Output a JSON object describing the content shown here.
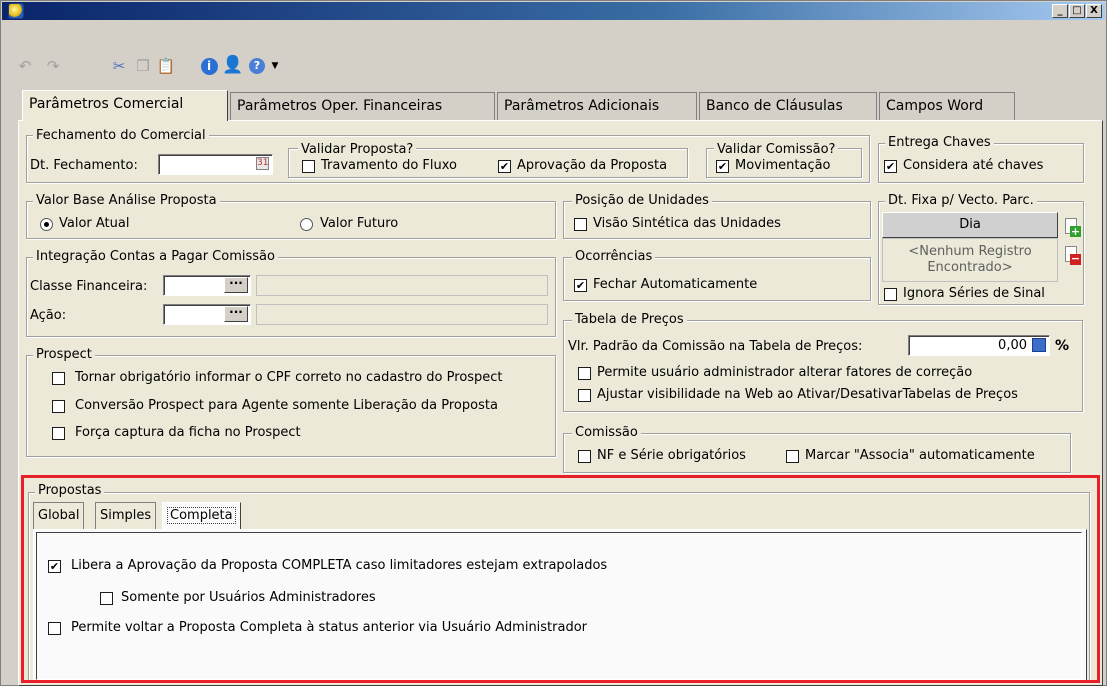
{
  "window": {
    "min_label": "_",
    "max_label": "□",
    "close_label": "X"
  },
  "toolbar": {
    "icons": [
      "undo-icon",
      "redo-icon",
      "cut-icon",
      "copy-icon",
      "paste-icon",
      "info-icon",
      "user-icon",
      "help-icon",
      "dropdown-icon"
    ]
  },
  "tabs": [
    {
      "label": "Parâmetros Comercial",
      "active": true
    },
    {
      "label": "Parâmetros Oper. Financeiras"
    },
    {
      "label": "Parâmetros Adicionais"
    },
    {
      "label": "Banco de Cláusulas"
    },
    {
      "label": "Campos Word"
    }
  ],
  "fechamento": {
    "title": "Fechamento do Comercial",
    "dt_label": "Dt. Fechamento:",
    "dt_value": "",
    "validar_proposta_title": "Validar Proposta?",
    "travamento": {
      "label": "Travamento do Fluxo",
      "checked": false
    },
    "aprovacao": {
      "label": "Aprovação da Proposta",
      "checked": true
    },
    "validar_comissao_title": "Validar Comissão?",
    "movimentacao": {
      "label": "Movimentação",
      "checked": true
    }
  },
  "entrega": {
    "title": "Entrega Chaves",
    "considera": {
      "label": "Considera até chaves",
      "checked": true
    }
  },
  "valor_base": {
    "title": "Valor Base Análise Proposta",
    "atual": {
      "label": "Valor Atual",
      "selected": true
    },
    "futuro": {
      "label": "Valor Futuro",
      "selected": false
    }
  },
  "posicao": {
    "title": "Posição de Unidades",
    "visao": {
      "label": "Visão Sintética das Unidades",
      "checked": false
    }
  },
  "dt_fixa": {
    "title": "Dt. Fixa p/ Vecto. Parc.",
    "dia_button": "Dia",
    "empty_line1": "<Nenhum Registro",
    "empty_line2": "Encontrado>",
    "ignora": {
      "label": "Ignora Séries de Sinal",
      "checked": false
    }
  },
  "integracao": {
    "title": "Integração Contas a Pagar Comissão",
    "classe_label": "Classe Financeira:",
    "acao_label": "Ação:",
    "ellipsis": "···"
  },
  "ocorrencias": {
    "title": "Ocorrências",
    "fechar": {
      "label": "Fechar Automaticamente",
      "checked": true
    }
  },
  "tabela": {
    "title": "Tabela de Preços",
    "vlr_label": "Vlr. Padrão da Comissão na Tabela de Preços:",
    "vlr_value": "0,00",
    "percent": "%",
    "permite": {
      "label": "Permite usuário administrador alterar fatores de correção",
      "checked": false
    },
    "ajustar": {
      "label": "Ajustar visibilidade na Web ao Ativar/DesativarTabelas de Preços",
      "checked": false
    }
  },
  "prospect": {
    "title": "Prospect",
    "items": [
      {
        "label": "Tornar obrigatório informar o CPF correto no cadastro do Prospect",
        "checked": false
      },
      {
        "label": "Conversão Prospect para Agente somente Liberação da Proposta",
        "checked": false
      },
      {
        "label": "Força captura da ficha no Prospect",
        "checked": false
      }
    ]
  },
  "comissao": {
    "title": "Comissão",
    "nf": {
      "label": "NF e Série obrigatórios",
      "checked": false
    },
    "marcar": {
      "label": "Marcar \"Associa\" automaticamente",
      "checked": false
    }
  },
  "propostas": {
    "title": "Propostas",
    "subtabs": [
      {
        "label": "Global"
      },
      {
        "label": "Simples"
      },
      {
        "label": "Completa",
        "active": true
      }
    ],
    "libera": {
      "label": "Libera a Aprovação da Proposta COMPLETA caso limitadores estejam extrapolados",
      "checked": true
    },
    "somente": {
      "label": "Somente por Usuários Administradores",
      "checked": false
    },
    "permite_voltar": {
      "label": "Permite voltar a Proposta Completa à status anterior via Usuário Administrador",
      "checked": false
    }
  },
  "colors": {
    "highlight": "#e8202a",
    "titlebar_start": "#0a246a",
    "titlebar_end": "#a6caf0"
  }
}
